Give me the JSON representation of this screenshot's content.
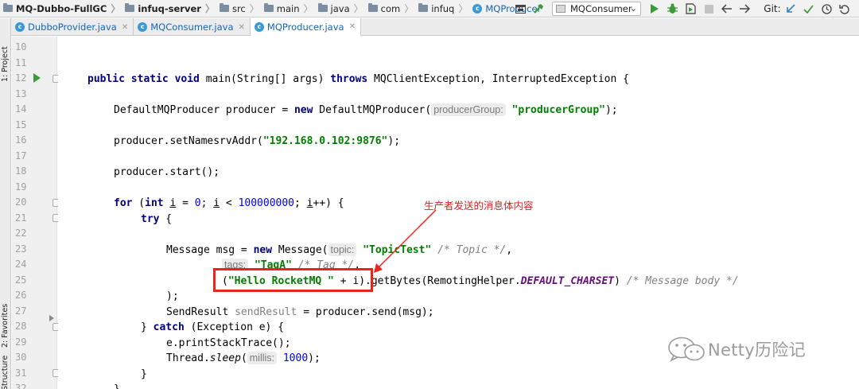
{
  "breadcrumb": {
    "project": "MQ-Dubbo-FullGC",
    "module": "infuq-server",
    "folders": [
      "src",
      "main",
      "java",
      "com",
      "infuq"
    ],
    "file": "MQProducer",
    "file_icon_letter": "c"
  },
  "toolbar": {
    "run_config": "MQConsumer",
    "git_label": "Git:",
    "icons": [
      "layout-icon",
      "hammer-icon",
      "run-icon",
      "debug-icon",
      "coverage-icon",
      "stop-icon",
      "back-icon",
      "forward-icon",
      "update-icon",
      "commit-icon",
      "history-icon",
      "rollback-icon"
    ]
  },
  "tabs": [
    {
      "label": "DubboProvider.java",
      "active": false
    },
    {
      "label": "MQConsumer.java",
      "active": false
    },
    {
      "label": "MQProducer.java",
      "active": true
    }
  ],
  "side_panels": {
    "project": "1: Project",
    "favorites": "2: Favorites",
    "structure": "Structure"
  },
  "editor": {
    "line_numbers": [
      "10",
      "11",
      "12",
      "13",
      "14",
      "15",
      "16",
      "17",
      "18",
      "19",
      "20",
      "21",
      "22",
      "23",
      "24",
      "25",
      "26",
      "27",
      "28",
      "29",
      "30",
      "31",
      "32"
    ],
    "lines": {
      "l12": {
        "kw1": "public static void",
        "t1": " main(String[] args) ",
        "kw2": "throws",
        "t2": " MQClientException, InterruptedException {"
      },
      "l14": {
        "t1": "DefaultMQProducer producer = ",
        "kw1": "new",
        "t2": " DefaultMQProducer(",
        "hint": "producerGroup:",
        "str": "\"producerGroup\"",
        "t3": ");"
      },
      "l16": {
        "t1": "producer.setNamesrvAddr(",
        "str": "\"192.168.0.102:9876\"",
        "t2": ");"
      },
      "l18": {
        "t1": "producer.start();"
      },
      "l20": {
        "kw1": "for",
        "t1": " (",
        "kw2": "int",
        "t2": " ",
        "v1": "i",
        "t3": " = ",
        "n1": "0",
        "t4": "; ",
        "v2": "i",
        "t5": " < ",
        "n2": "100000000",
        "t6": "; ",
        "v3": "i",
        "t7": "++) {"
      },
      "l21": {
        "kw1": "try",
        "t1": " {"
      },
      "l23": {
        "t1": "Message msg = ",
        "kw1": "new",
        "t2": " Message(",
        "hint": "topic:",
        "str": "\"TopicTest\"",
        "t3": " ",
        "cmt": "/* Topic */",
        "t4": ","
      },
      "l24": {
        "hint": "tags:",
        "str": "\"TagA\"",
        "t1": " ",
        "cmt": "/* Tag */",
        "t2": ","
      },
      "l25": {
        "t1": "(",
        "str": "\"Hello RocketMQ \"",
        "t2": " + i).getBytes(RemotingHelper.",
        "const": "DEFAULT_CHARSET",
        "t3": ") ",
        "cmt": "/* Message body */"
      },
      "l26": {
        "t1": ");"
      },
      "l27": {
        "t1": "SendResult ",
        "unused": "sendResult",
        "t2": " = producer.send(msg);"
      },
      "l28": {
        "t1": "} ",
        "kw1": "catch",
        "t2": " (Exception e) {"
      },
      "l29": {
        "t1": "e.printStackTrace();"
      },
      "l30": {
        "t1": "Thread.",
        "ital": "sleep",
        "t2": "(",
        "hint": "millis:",
        "n1": "1000",
        "t3": ");"
      },
      "l31": {
        "t1": "}"
      },
      "l32": {
        "t1": "}"
      }
    }
  },
  "annotation": {
    "label": "生产者发送的消息体内容",
    "color": "#e8241b"
  },
  "watermark": {
    "text": "Netty历险记",
    "icon": "wechat-icon"
  }
}
